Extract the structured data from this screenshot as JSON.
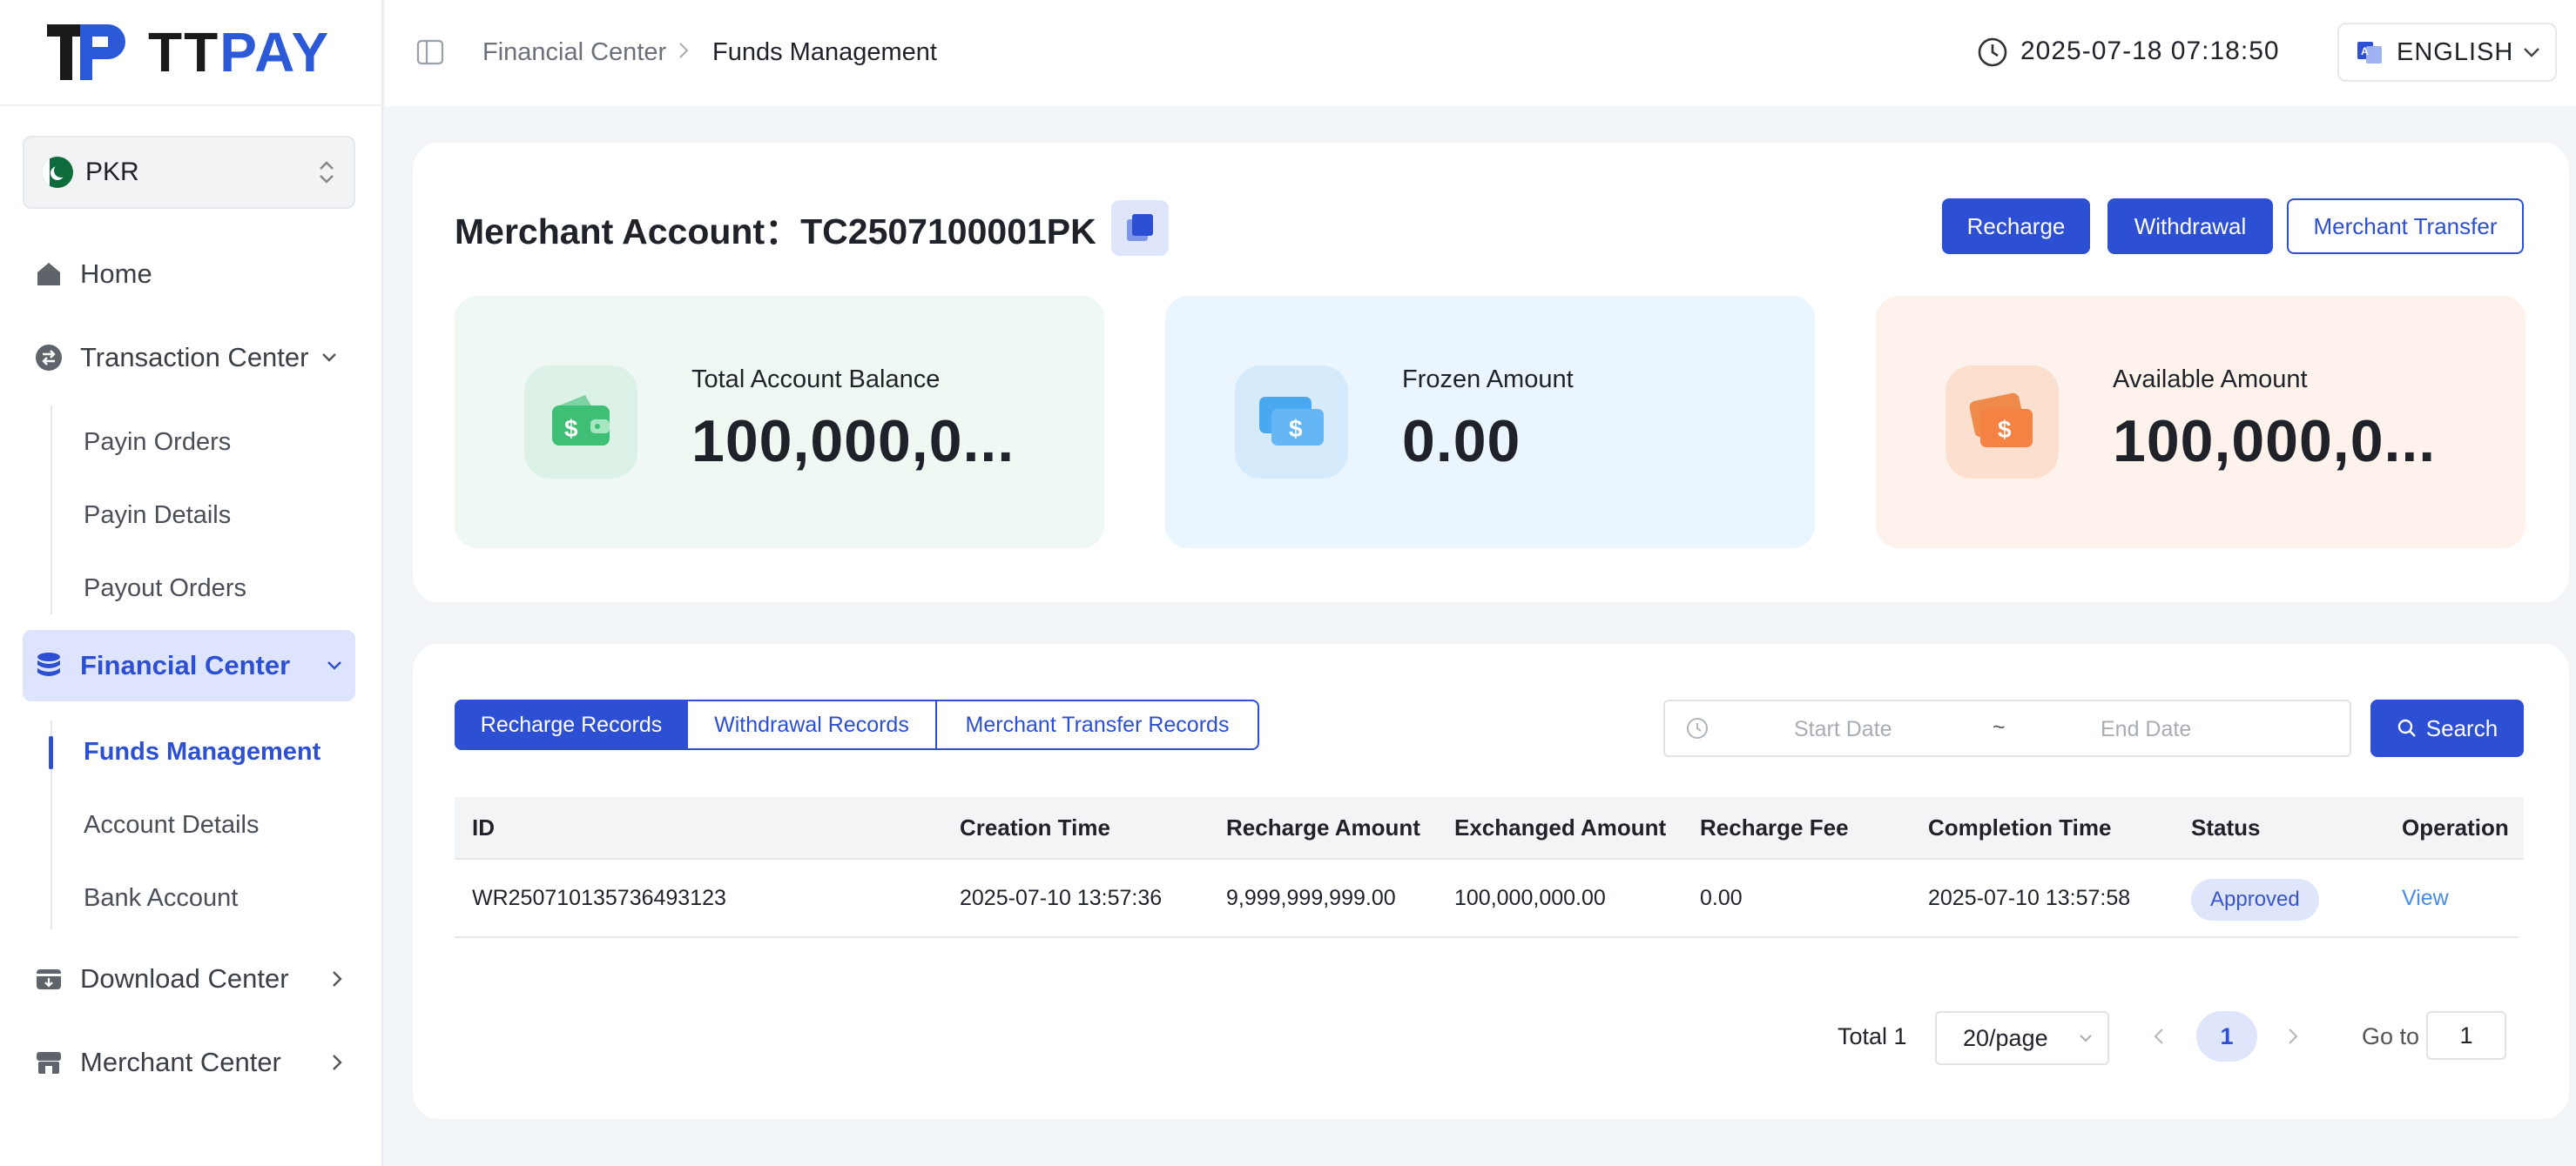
{
  "brand": {
    "logo_left": "TT",
    "logo_right": "PAY"
  },
  "sidebar": {
    "currency": "PKR",
    "items": [
      {
        "label": "Home"
      },
      {
        "label": "Transaction Center"
      },
      {
        "label": "Payin Orders"
      },
      {
        "label": "Payin Details"
      },
      {
        "label": "Payout Orders"
      },
      {
        "label": "Financial Center"
      },
      {
        "label": "Funds Management"
      },
      {
        "label": "Account Details"
      },
      {
        "label": "Bank Account"
      },
      {
        "label": "Download Center"
      },
      {
        "label": "Merchant Center"
      }
    ]
  },
  "header": {
    "breadcrumb": [
      "Financial Center",
      "Funds Management"
    ],
    "datetime": "2025-07-18 07:18:50",
    "language": "ENGLISH"
  },
  "account": {
    "title": "Merchant Account：TC2507100001PK",
    "buttons": {
      "recharge": "Recharge",
      "withdrawal": "Withdrawal",
      "transfer": "Merchant Transfer"
    },
    "stats": [
      {
        "label": "Total Account Balance",
        "value": "100,000,0..."
      },
      {
        "label": "Frozen Amount",
        "value": "0.00"
      },
      {
        "label": "Available Amount",
        "value": "100,000,0..."
      }
    ]
  },
  "records": {
    "tabs": [
      "Recharge Records",
      "Withdrawal Records",
      "Merchant Transfer Records"
    ],
    "date_range": {
      "start_placeholder": "Start Date",
      "separator": "~",
      "end_placeholder": "End Date"
    },
    "search_label": "Search",
    "columns": [
      "ID",
      "Creation Time",
      "Recharge Amount",
      "Exchanged Amount",
      "Recharge Fee",
      "Completion Time",
      "Status",
      "Operation"
    ],
    "rows": [
      {
        "id": "WR250710135736493123",
        "created": "2025-07-10 13:57:36",
        "recharge_amount": "9,999,999,999.00",
        "exchanged_amount": "100,000,000.00",
        "fee": "0.00",
        "completed": "2025-07-10 13:57:58",
        "status": "Approved",
        "operation": "View"
      }
    ],
    "pagination": {
      "total": "Total 1",
      "page_size": "20/page",
      "current_page": "1",
      "goto_label": "Go to",
      "goto_value": "1"
    }
  },
  "colors": {
    "accent": "#2c4fd3",
    "green_card": "#eff8f3",
    "blue_card": "#eaf5fd",
    "orange_card": "#fdf2ec"
  }
}
